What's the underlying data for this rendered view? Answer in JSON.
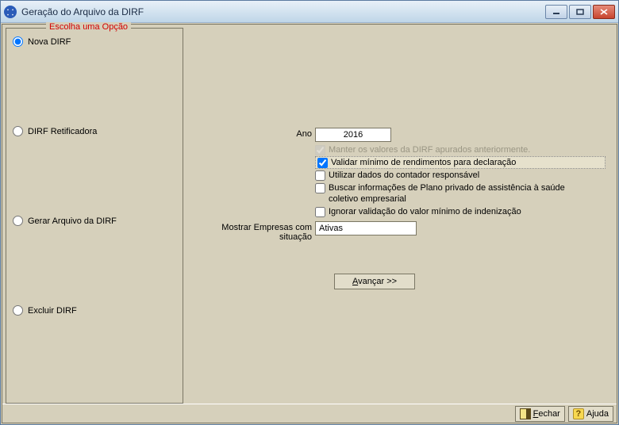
{
  "window": {
    "title": "Geração do Arquivo da  DIRF"
  },
  "groupbox": {
    "legend": "Escolha uma Opção",
    "options": [
      {
        "label": "Nova DIRF",
        "selected": true
      },
      {
        "label": "DIRF Retificadora",
        "selected": false
      },
      {
        "label": "Gerar Arquivo da DIRF",
        "selected": false
      },
      {
        "label": "Excluir DIRF",
        "selected": false
      }
    ]
  },
  "form": {
    "ano_label": "Ano",
    "ano_value": "2016",
    "checks": [
      {
        "label": "Manter os valores da DIRF apurados anteriormente.",
        "checked": true,
        "disabled": true
      },
      {
        "label": "Validar mínimo de rendimentos para declaração",
        "checked": true,
        "highlight": true
      },
      {
        "label": "Utilizar dados do contador responsável",
        "checked": false
      },
      {
        "label": "Buscar informações de Plano privado de assistência à saúde coletivo empresarial",
        "checked": false
      },
      {
        "label": "Ignorar validação do valor mínimo de indenização",
        "checked": false
      }
    ],
    "mostrar_label": "Mostrar Empresas com situação",
    "mostrar_value": "Ativas",
    "avancar_prefix": "A",
    "avancar_suffix": "vançar >>"
  },
  "status": {
    "fechar_prefix": "F",
    "fechar_suffix": "echar",
    "ajuda": "Ajuda"
  }
}
